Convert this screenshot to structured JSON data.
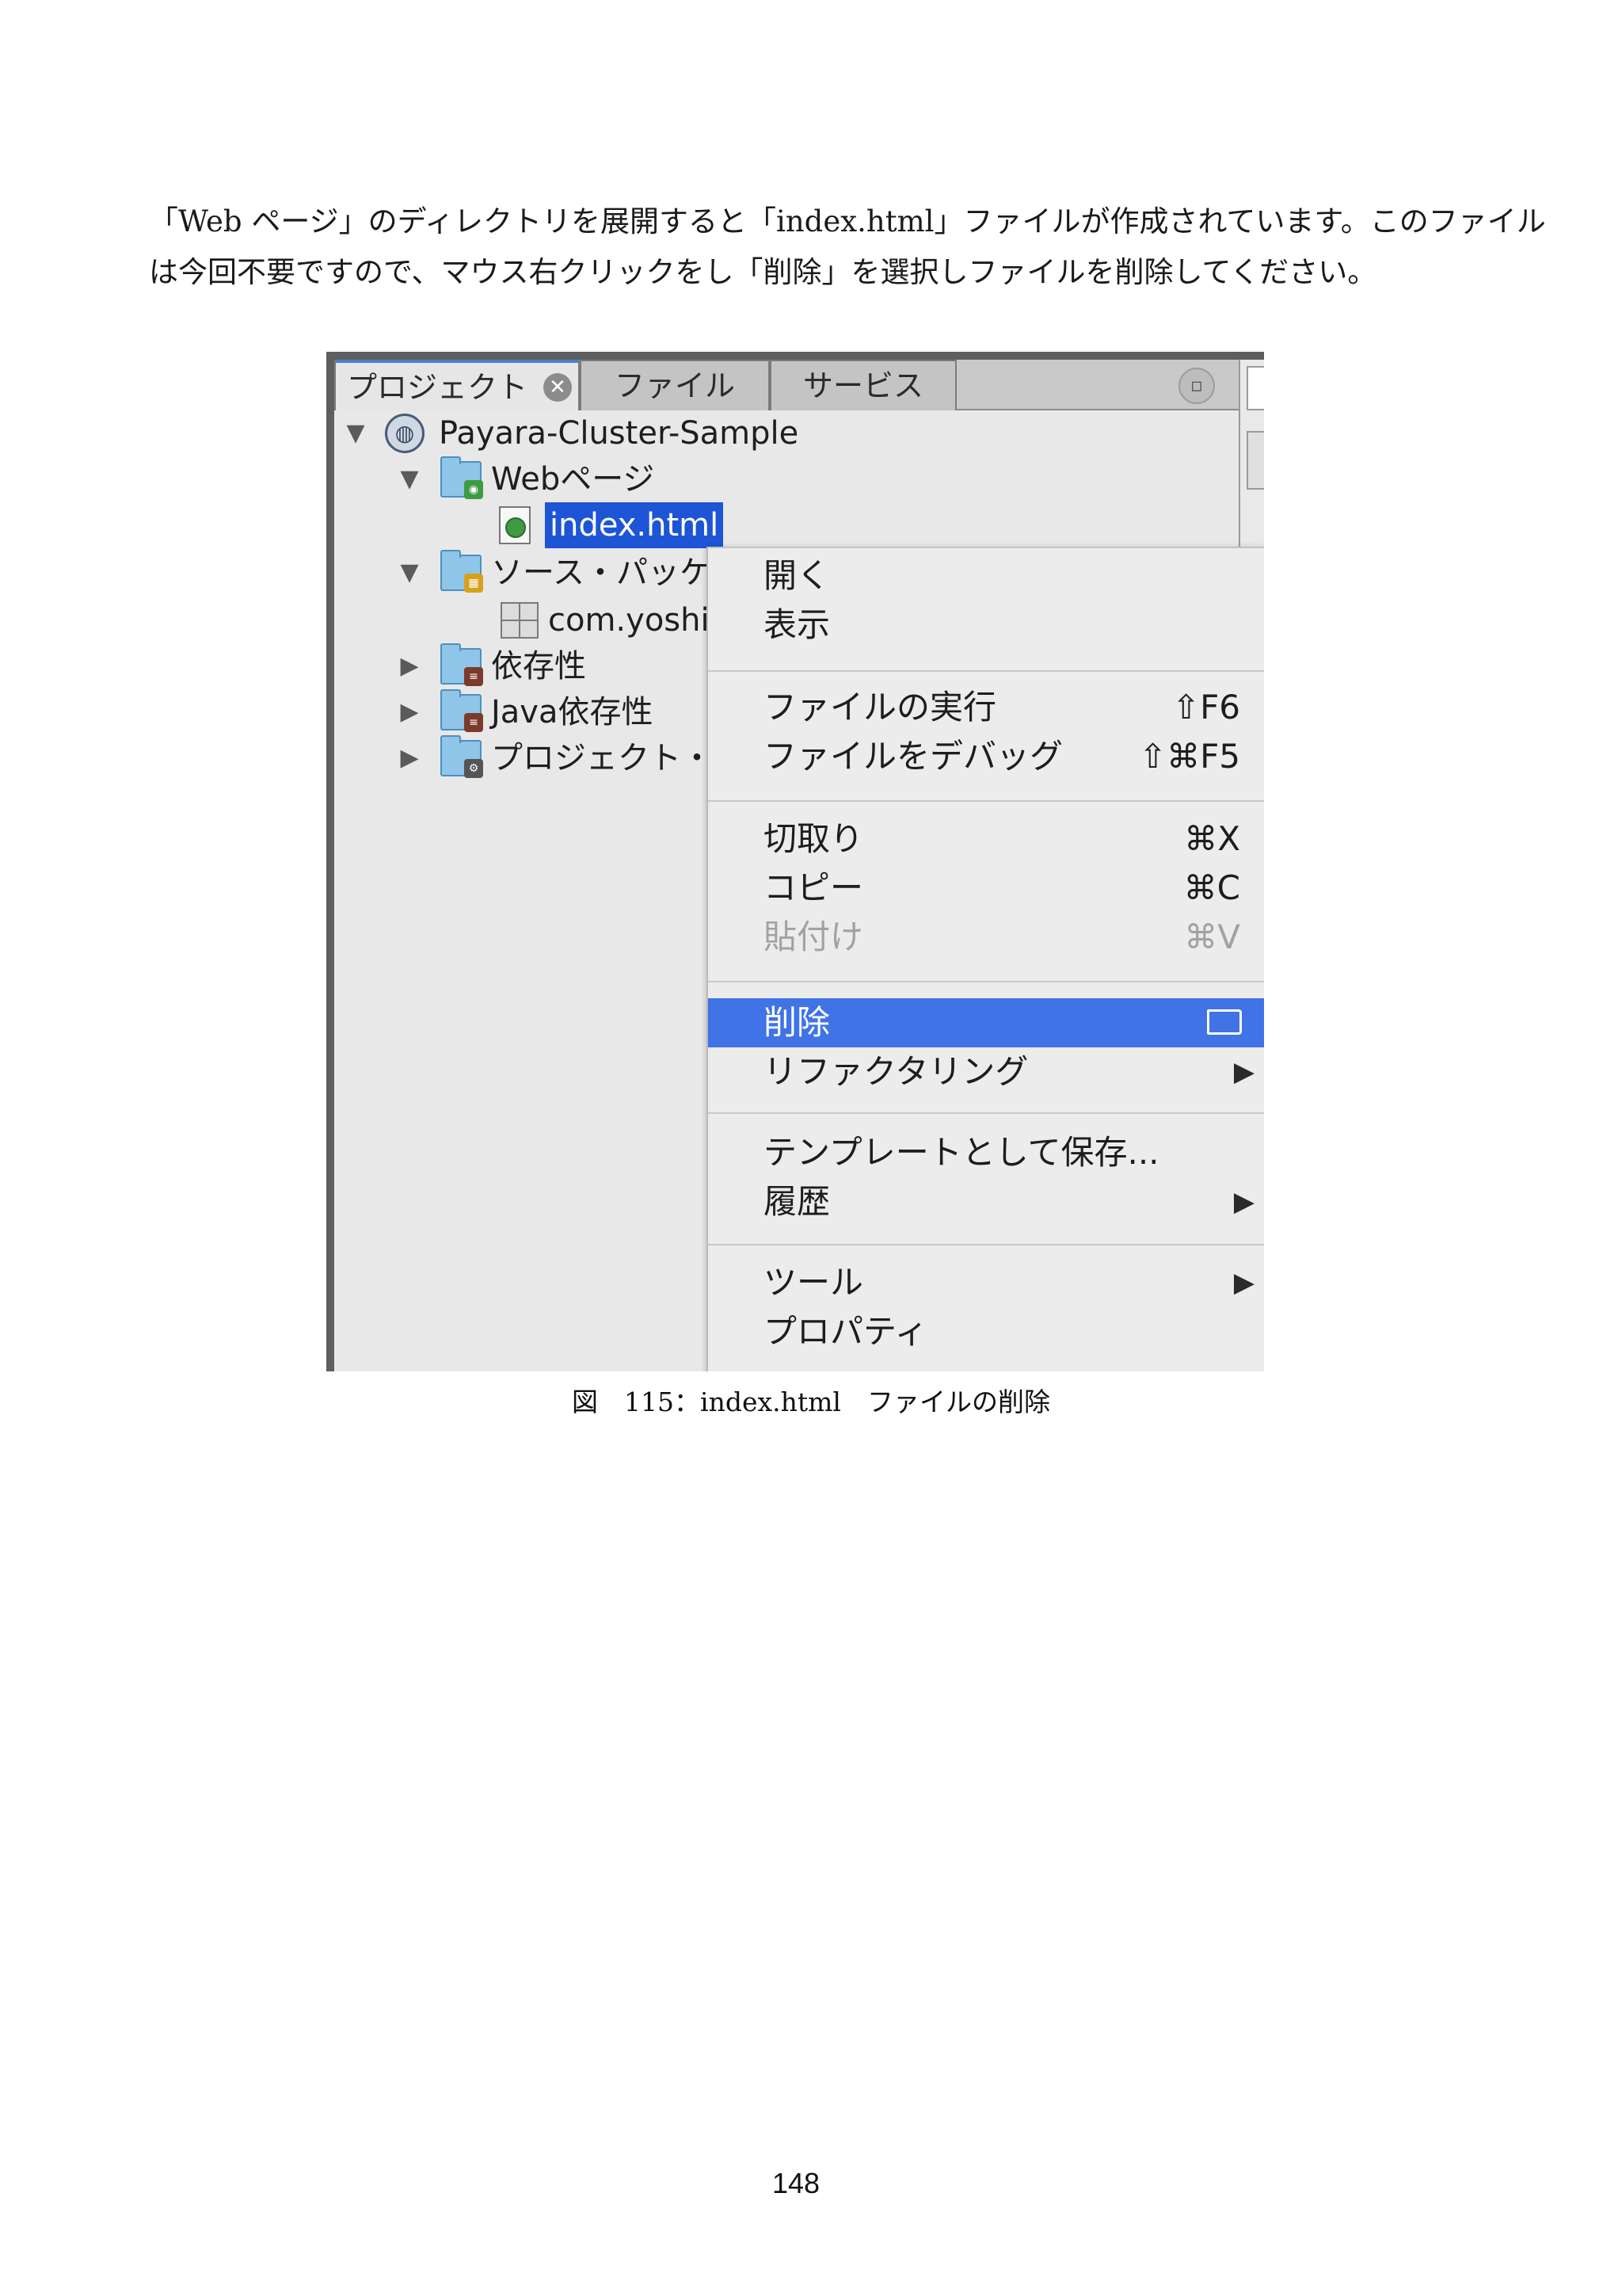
{
  "paragraph": {
    "line1": "「Web ページ」のディレクトリを展開すると「index.html」ファイルが作成されています。このファイル",
    "line2": "は今回不要ですので、マウス右クリックをし「削除」を選択しファイルを削除してください。"
  },
  "ide": {
    "tabs": [
      {
        "label": "プロジェクト",
        "active": true
      },
      {
        "label": "ファイル",
        "active": false
      },
      {
        "label": "サービス",
        "active": false
      }
    ],
    "tree": [
      {
        "label": "Payara-Cluster-Sample",
        "icon": "globe-project-icon",
        "expanded": true
      },
      {
        "label": "Webページ",
        "icon": "web-folder-icon",
        "expanded": true
      },
      {
        "label": "index.html",
        "icon": "html-file-icon",
        "selected": true
      },
      {
        "label": "ソース・パッケ",
        "icon": "source-folder-icon",
        "expanded": true
      },
      {
        "label": "com.yoshi",
        "icon": "package-icon"
      },
      {
        "label": "依存性",
        "icon": "dependency-folder-icon",
        "expanded": false
      },
      {
        "label": "Java依存性",
        "icon": "java-dependency-folder-icon",
        "expanded": false
      },
      {
        "label": "プロジェクト・",
        "icon": "project-files-folder-icon",
        "expanded": false
      }
    ],
    "context_menu": {
      "items": [
        {
          "label": "開く",
          "shortcut": ""
        },
        {
          "label": "表示",
          "shortcut": ""
        },
        {
          "label": "ファイルの実行",
          "shortcut": "⇧F6"
        },
        {
          "label": "ファイルをデバッグ",
          "shortcut": "⇧⌘F5"
        },
        {
          "label": "切取り",
          "shortcut": "⌘X"
        },
        {
          "label": "コピー",
          "shortcut": "⌘C"
        },
        {
          "label": "貼付け",
          "shortcut": "⌘V",
          "disabled": true
        },
        {
          "label": "削除",
          "shortcut": "⌦",
          "highlighted": true
        },
        {
          "label": "リファクタリング",
          "submenu": true
        },
        {
          "label": "テンプレートとして保存...",
          "shortcut": ""
        },
        {
          "label": "履歴",
          "submenu": true
        },
        {
          "label": "ツール",
          "submenu": true
        },
        {
          "label": "プロパティ",
          "shortcut": ""
        }
      ],
      "highlight_color": "#3f73e6"
    }
  },
  "caption": "図　115：index.html　ファイルの削除",
  "page_number": "148"
}
